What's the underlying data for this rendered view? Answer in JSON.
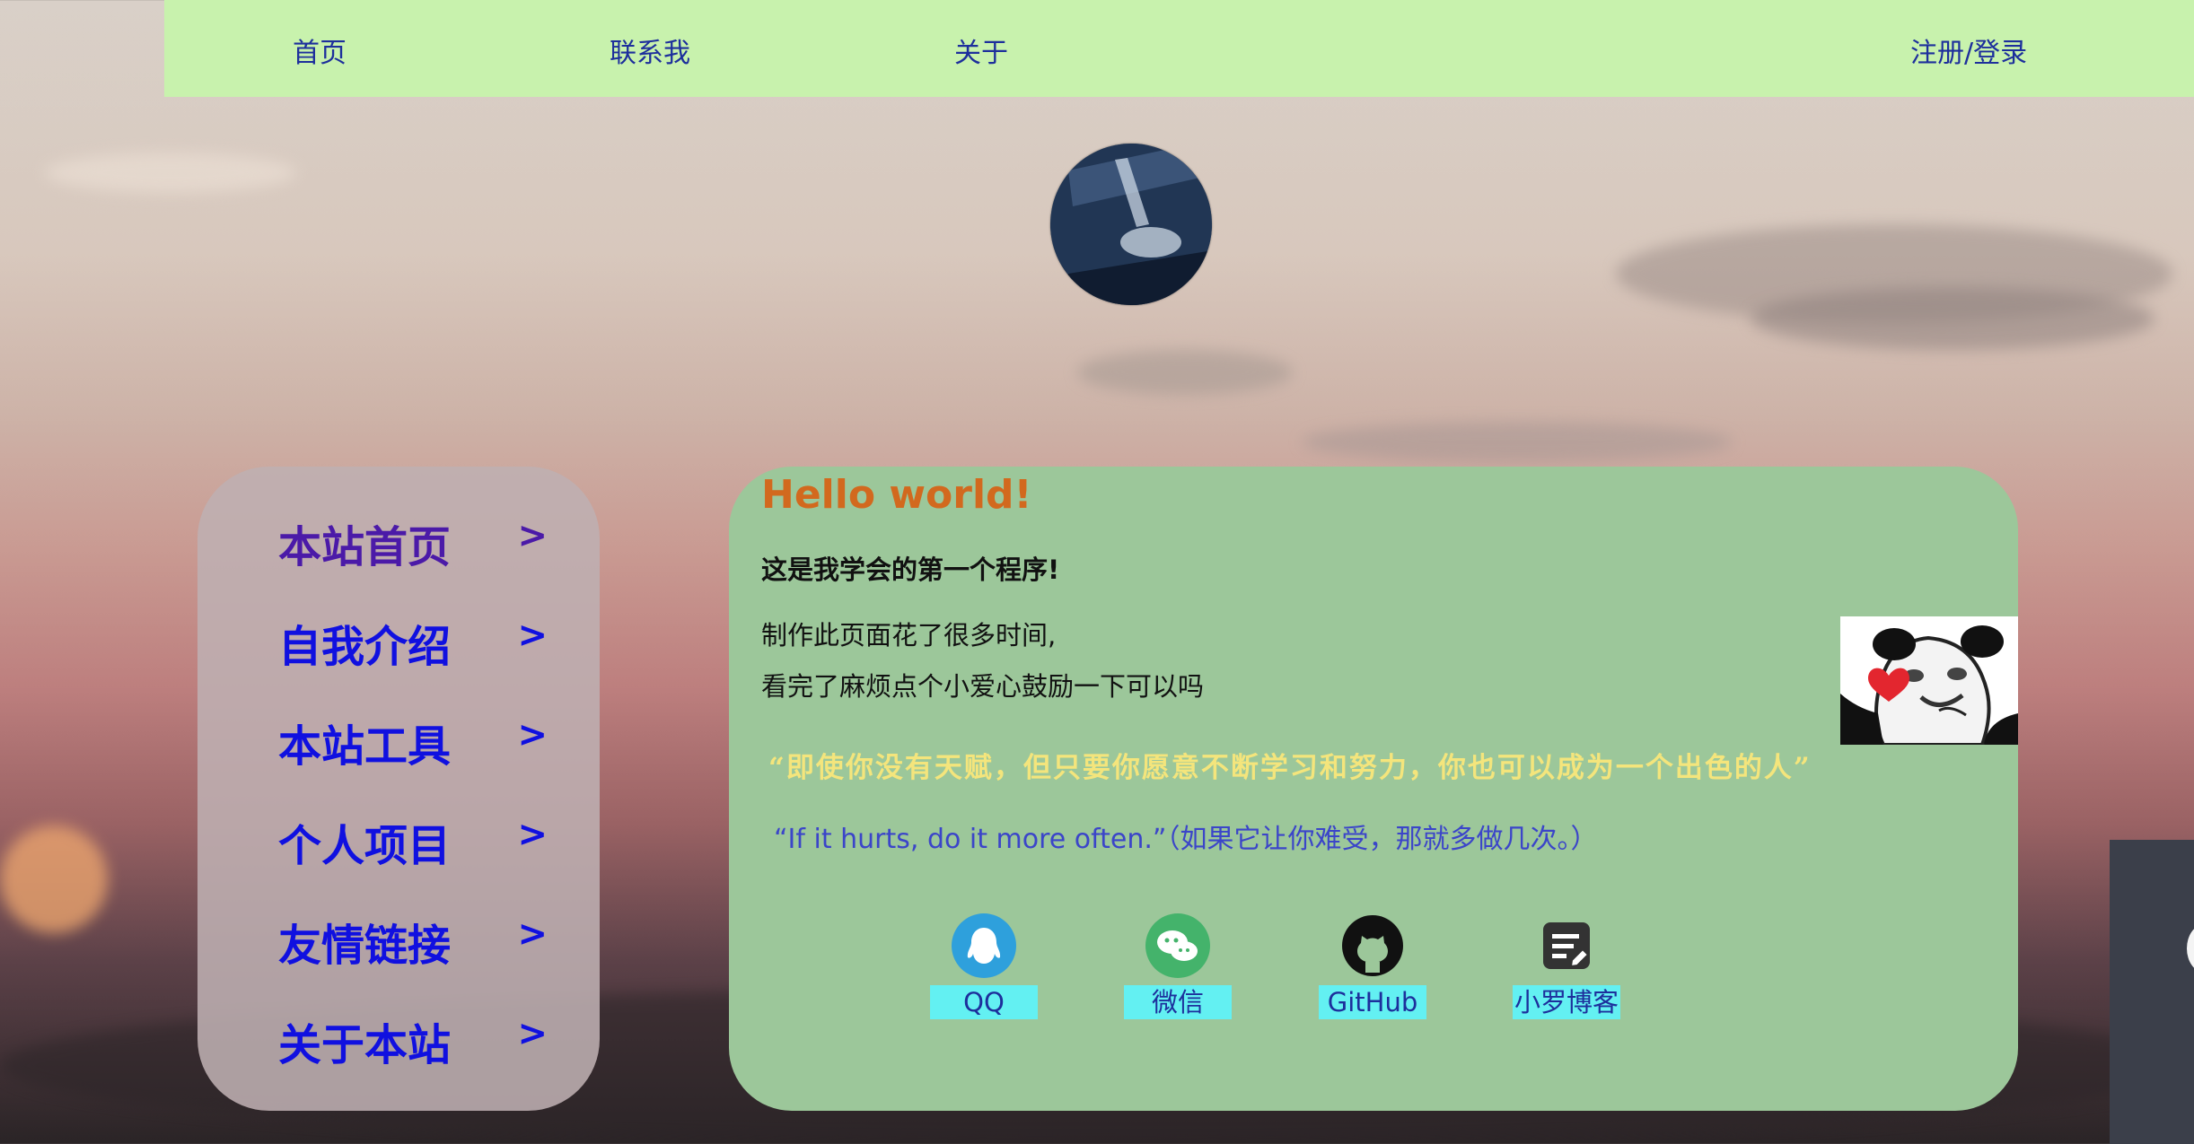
{
  "nav": {
    "home": "首页",
    "contact": "联系我",
    "about": "关于",
    "auth": "注册/登录"
  },
  "sidebar": {
    "items": [
      {
        "label": "本站首页",
        "arrow": ">"
      },
      {
        "label": "自我介绍",
        "arrow": ">"
      },
      {
        "label": "本站工具",
        "arrow": ">"
      },
      {
        "label": "个人项目",
        "arrow": ">"
      },
      {
        "label": "友情链接",
        "arrow": ">"
      },
      {
        "label": "关于本站",
        "arrow": ">"
      }
    ]
  },
  "main": {
    "title": "Hello world!",
    "subtitle": "这是我学会的第一个程序!",
    "line1": "制作此页面花了很多时间,",
    "line2": "看完了麻烦点个小爱心鼓励一下可以吗",
    "quote": "“即使你没有天赋，但只要你愿意不断学习和努力，你也可以成为一个出色的人”",
    "english_quote": "“If it hurts, do it more often.”（如果它让你难受，那就多做几次。）"
  },
  "socials": [
    {
      "label": "QQ",
      "icon": "qq-icon"
    },
    {
      "label": "微信",
      "icon": "wechat-icon"
    },
    {
      "label": "GitHub",
      "icon": "github-icon"
    },
    {
      "label": "小罗博客",
      "icon": "blog-icon"
    }
  ],
  "colors": {
    "nav_background": "#c8f2ad",
    "card_background": "#9cc79a",
    "title": "#d2691e",
    "menu_link": "#1010e0",
    "quote": "#f4e57c",
    "social_label_background": "#63f0f2"
  }
}
